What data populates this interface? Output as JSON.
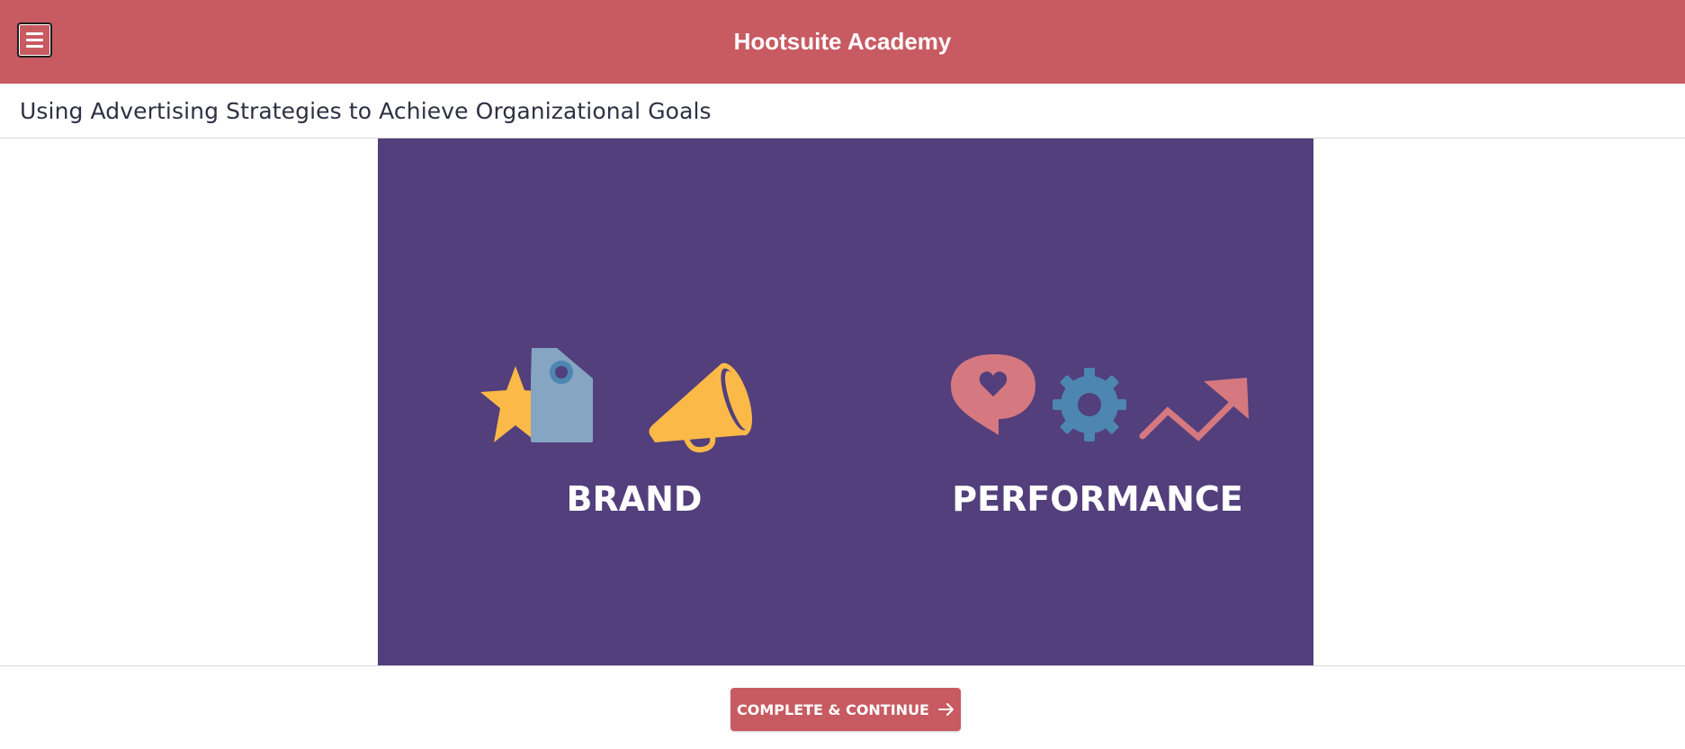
{
  "header": {
    "title": "Hootsuite Academy",
    "menu_icon": "hamburger-menu-icon",
    "background_color": "#c85a61"
  },
  "lesson": {
    "title": "Using Advertising Strategies to Achieve Organizational Goals"
  },
  "slide": {
    "background_color": "#523f7c",
    "groups": [
      {
        "label": "BRAND",
        "icons": [
          "star-icon",
          "price-tag-icon",
          "megaphone-icon"
        ]
      },
      {
        "label": "PERFORMANCE",
        "icons": [
          "heart-speech-bubble-icon",
          "gear-icon",
          "trending-up-arrow-icon"
        ]
      }
    ]
  },
  "footer": {
    "continue_label": "COMPLETE & CONTINUE",
    "continue_icon": "arrow-right-icon"
  },
  "colors": {
    "accent": "#c85a61",
    "slide_bg": "#523f7c",
    "yellow": "#fbb947",
    "tag_blue": "#85a5c2",
    "gear_blue": "#4d86b0",
    "pink": "#d6787f"
  }
}
